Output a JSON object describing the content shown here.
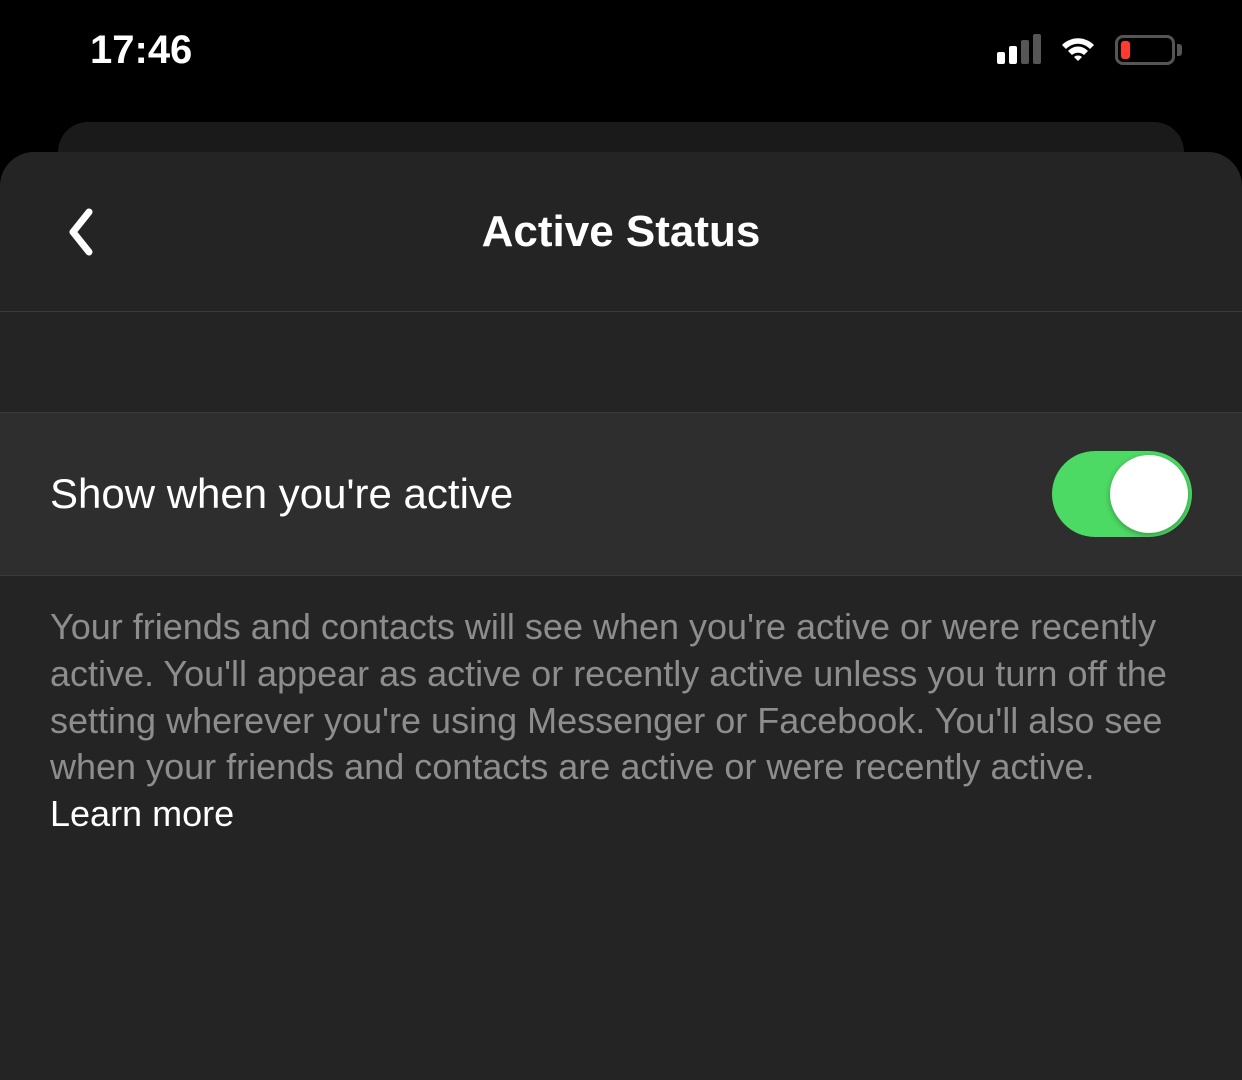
{
  "status_bar": {
    "time": "17:46"
  },
  "header": {
    "title": "Active Status"
  },
  "setting": {
    "label": "Show when you're active",
    "enabled": true
  },
  "description": {
    "text": "Your friends and contacts will see when you're active or were recently active. You'll appear as active or recently active unless you turn off the setting wherever you're using Messenger or Facebook. You'll also see when your friends and contacts are active or were recently active. ",
    "learn_more": "Learn more"
  }
}
